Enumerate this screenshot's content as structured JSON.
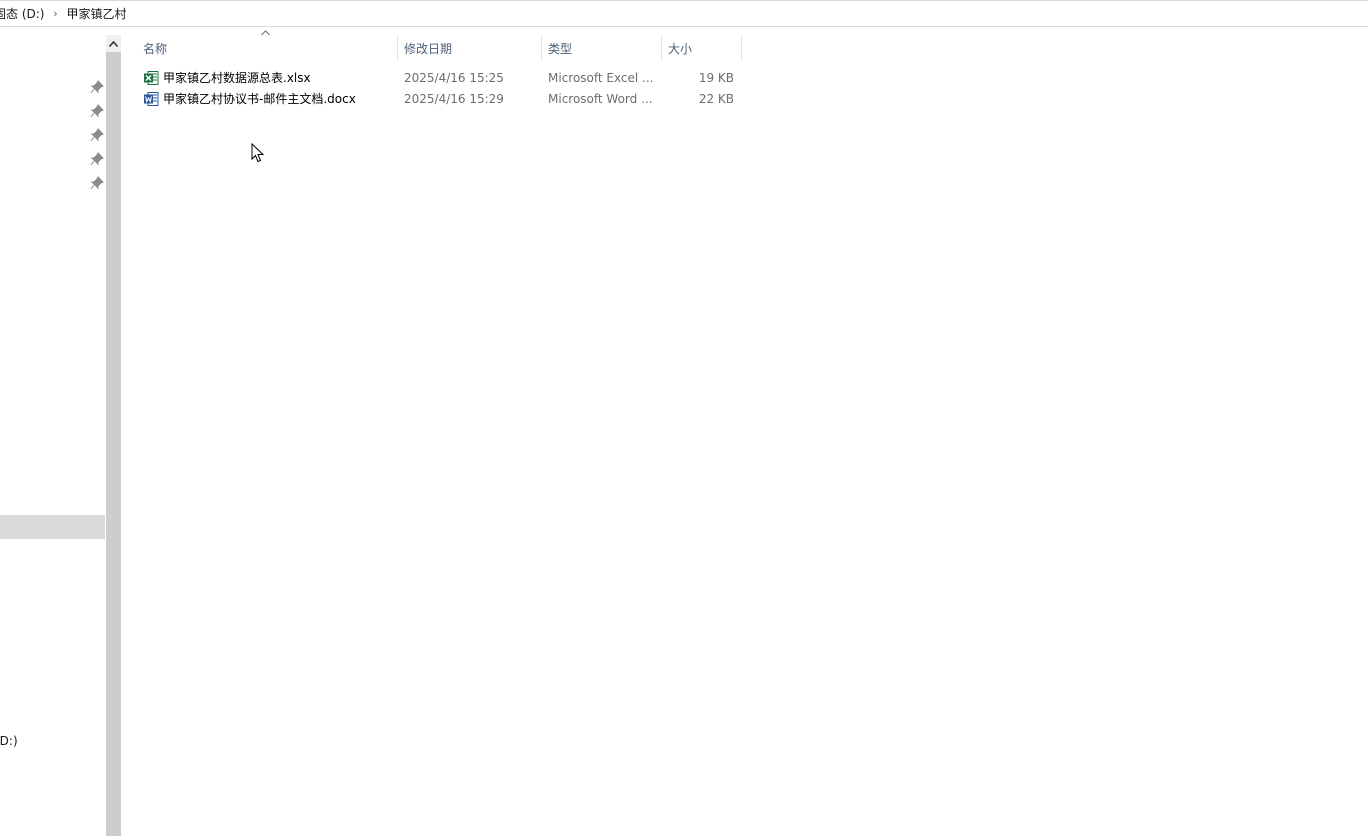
{
  "breadcrumb": {
    "drive": "固态 (D:)",
    "folder": "甲家镇乙村"
  },
  "nav": {
    "pinned_count": 5,
    "drive_label": "(D:)"
  },
  "columns": {
    "name": "名称",
    "modified": "修改日期",
    "type": "类型",
    "size": "大小"
  },
  "files": [
    {
      "name": "甲家镇乙村数据源总表.xlsx",
      "modified": "2025/4/16 15:25",
      "type": "Microsoft Excel ...",
      "size": "19 KB",
      "icon": "excel-file-icon"
    },
    {
      "name": "甲家镇乙村协议书-邮件主文档.docx",
      "modified": "2025/4/16 15:29",
      "type": "Microsoft Word ...",
      "size": "22 KB",
      "icon": "word-file-icon"
    }
  ],
  "colors": {
    "header_text": "#4c607a",
    "excel_green": "#1e7145",
    "word_blue": "#2b579a",
    "selection_grey": "#d9d9d9"
  }
}
